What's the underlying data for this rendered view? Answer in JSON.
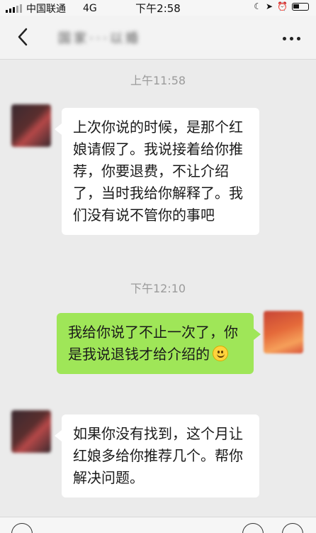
{
  "status_bar": {
    "carrier": "中国联通",
    "network": "4G",
    "time": "下午2:58"
  },
  "nav": {
    "title": "国家···以婚"
  },
  "messages": [
    {
      "type": "timestamp",
      "text": "上午11:58"
    },
    {
      "type": "incoming",
      "text": "上次你说的时候，是那个红娘请假了。我说接着给你推荐，你要退费，不让介绍了，当时我给你解释了。我们没有说不管你的事吧"
    },
    {
      "type": "timestamp",
      "text": "下午12:10"
    },
    {
      "type": "outgoing",
      "text": "我给你说了不止一次了，你是我说退钱才给介绍的",
      "emoji": "smile-emoji"
    },
    {
      "type": "incoming",
      "text": "如果你没有找到，这个月让红娘多给你推荐几个。帮你解决问题。"
    }
  ],
  "colors": {
    "chat_bg": "#ebebeb",
    "outgoing_bubble": "#9fe658",
    "incoming_bubble": "#ffffff"
  }
}
